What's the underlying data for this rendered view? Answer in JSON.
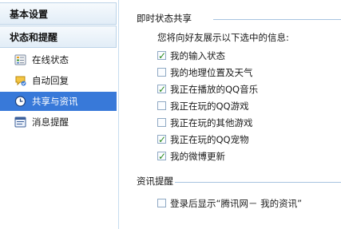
{
  "sidebar": {
    "basic_settings": "基本设置",
    "status_reminders": "状态和提醒",
    "items": [
      {
        "label": "在线状态",
        "icon": "online-status-icon"
      },
      {
        "label": "自动回复",
        "icon": "auto-reply-icon"
      },
      {
        "label": "共享与资讯",
        "icon": "clock-icon",
        "selected": true
      },
      {
        "label": "消息提醒",
        "icon": "message-reminder-icon"
      }
    ]
  },
  "main": {
    "share_section": {
      "title": "即时状态共享",
      "description": "您将向好友展示以下选中的信息:",
      "options": [
        {
          "label": "我的输入状态",
          "checked": true
        },
        {
          "label": "我的地理位置及天气",
          "checked": false
        },
        {
          "label": "我正在播放的QQ音乐",
          "checked": true
        },
        {
          "label": "我正在玩的QQ游戏",
          "checked": false
        },
        {
          "label": "我正在玩的其他游戏",
          "checked": false
        },
        {
          "label": "我正在玩的QQ宠物",
          "checked": true
        },
        {
          "label": "我的微博更新",
          "checked": true
        }
      ]
    },
    "news_section": {
      "title": "资讯提醒",
      "options": [
        {
          "label": "登录后显示“腾讯网－ 我的资讯”",
          "checked": false
        }
      ]
    }
  },
  "colors": {
    "selected_bg": "#3879d9",
    "check": "#2a8a1e",
    "divider": "#a7c3e0"
  }
}
